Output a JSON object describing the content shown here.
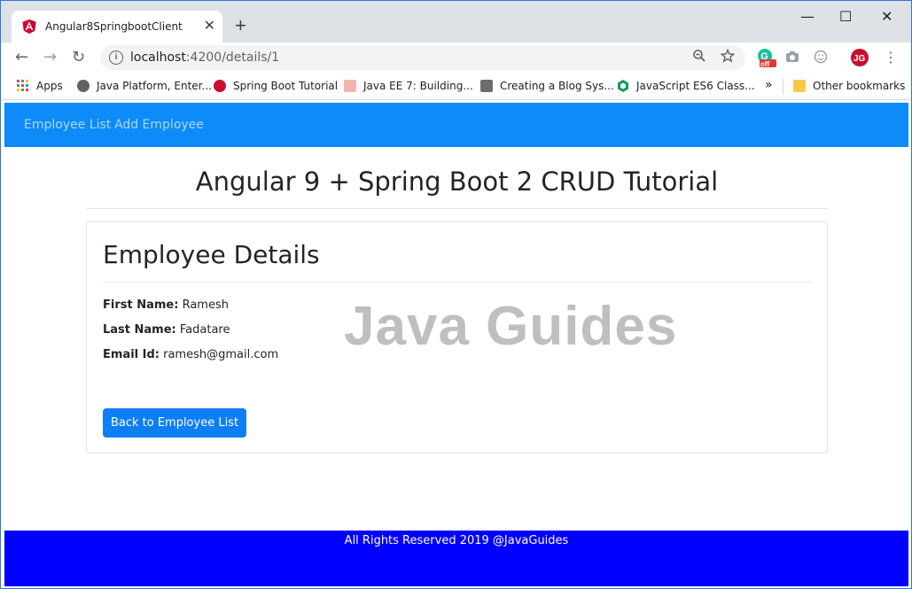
{
  "browser": {
    "tab_title": "Angular8SpringbootClient",
    "tab_close": "✕",
    "new_tab": "+",
    "window_controls": {
      "minimize": "—",
      "maximize": "☐",
      "close": "✕"
    },
    "nav": {
      "back": "←",
      "forward": "→",
      "reload": "↻"
    },
    "url": {
      "host": "localhost",
      "path": ":4200/details/1"
    },
    "omnibox_icons": {
      "zoom": "zoom-icon",
      "star": "star-icon"
    },
    "extension_badge": "off",
    "bookmarks": [
      {
        "label": "Apps",
        "icon": "apps-grid-icon"
      },
      {
        "label": "Java Platform, Enter...",
        "icon": "globe-icon"
      },
      {
        "label": "Spring Boot Tutorial",
        "icon": "javaguides-icon"
      },
      {
        "label": "Java EE 7: Building...",
        "icon": "oracle-icon"
      },
      {
        "label": "Creating a Blog Sys...",
        "icon": "idk-icon"
      },
      {
        "label": "JavaScript ES6 Class...",
        "icon": "hexagon-icon"
      }
    ],
    "bookmarks_overflow": "»",
    "other_bookmarks": "Other bookmarks"
  },
  "app": {
    "navbar": {
      "employee_list": "Employee List",
      "add_employee": "Add Employee"
    },
    "page_title": "Angular 9 + Spring Boot 2 CRUD Tutorial",
    "details": {
      "heading": "Employee Details",
      "first_name_label": "First Name:",
      "first_name": "Ramesh",
      "last_name_label": "Last Name:",
      "last_name": "Fadatare",
      "email_label": "Email Id:",
      "email": "ramesh@gmail.com",
      "back_button": "Back to Employee List"
    },
    "watermark": "Java Guides",
    "footer": "All Rights Reserved 2019 @JavaGuides"
  },
  "colors": {
    "navbar": "#0d8bf8",
    "button": "#0d7ef6",
    "footer": "#0000ff",
    "watermark": "#bfbfbf"
  }
}
